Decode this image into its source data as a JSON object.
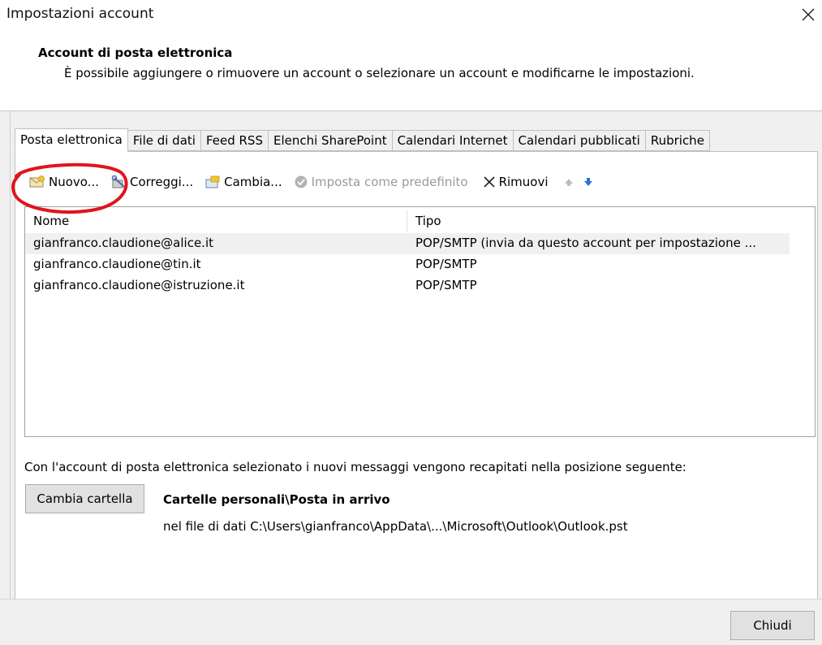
{
  "window": {
    "title": "Impostazioni account",
    "close_icon": "close-icon"
  },
  "header": {
    "title": "Account di posta elettronica",
    "description": "È possibile aggiungere o rimuovere un account o selezionare un account e modificarne le impostazioni."
  },
  "tabs": [
    {
      "label": "Posta elettronica",
      "active": true
    },
    {
      "label": "File di dati",
      "active": false
    },
    {
      "label": "Feed RSS",
      "active": false
    },
    {
      "label": "Elenchi SharePoint",
      "active": false
    },
    {
      "label": "Calendari Internet",
      "active": false
    },
    {
      "label": "Calendari pubblicati",
      "active": false
    },
    {
      "label": "Rubriche",
      "active": false
    }
  ],
  "toolbar": {
    "new_label": "Nuovo...",
    "repair_label": "Correggi...",
    "change_label": "Cambia...",
    "set_default_label": "Imposta come predefinito",
    "remove_label": "Rimuovi"
  },
  "list": {
    "columns": [
      "Nome",
      "Tipo"
    ],
    "rows": [
      {
        "name": "gianfranco.claudione@alice.it",
        "type": "POP/SMTP (invia da questo account per impostazione ...",
        "selected": true
      },
      {
        "name": "gianfranco.claudione@tin.it",
        "type": "POP/SMTP",
        "selected": false
      },
      {
        "name": "gianfranco.claudione@istruzione.it",
        "type": "POP/SMTP",
        "selected": false
      }
    ]
  },
  "delivery": {
    "info": "Con l'account di posta elettronica selezionato i nuovi messaggi vengono recapitati nella posizione seguente:",
    "change_folder_label": "Cambia cartella",
    "folder_path": "Cartelle personali\\Posta in arrivo",
    "file_path": "nel file di dati C:\\Users\\gianfranco\\AppData\\...\\Microsoft\\Outlook\\Outlook.pst"
  },
  "footer": {
    "close_label": "Chiudi"
  },
  "colors": {
    "annotation_red": "#e0141e",
    "arrow_blue": "#2f6fd8",
    "disabled_gray": "#9a9a9a"
  }
}
